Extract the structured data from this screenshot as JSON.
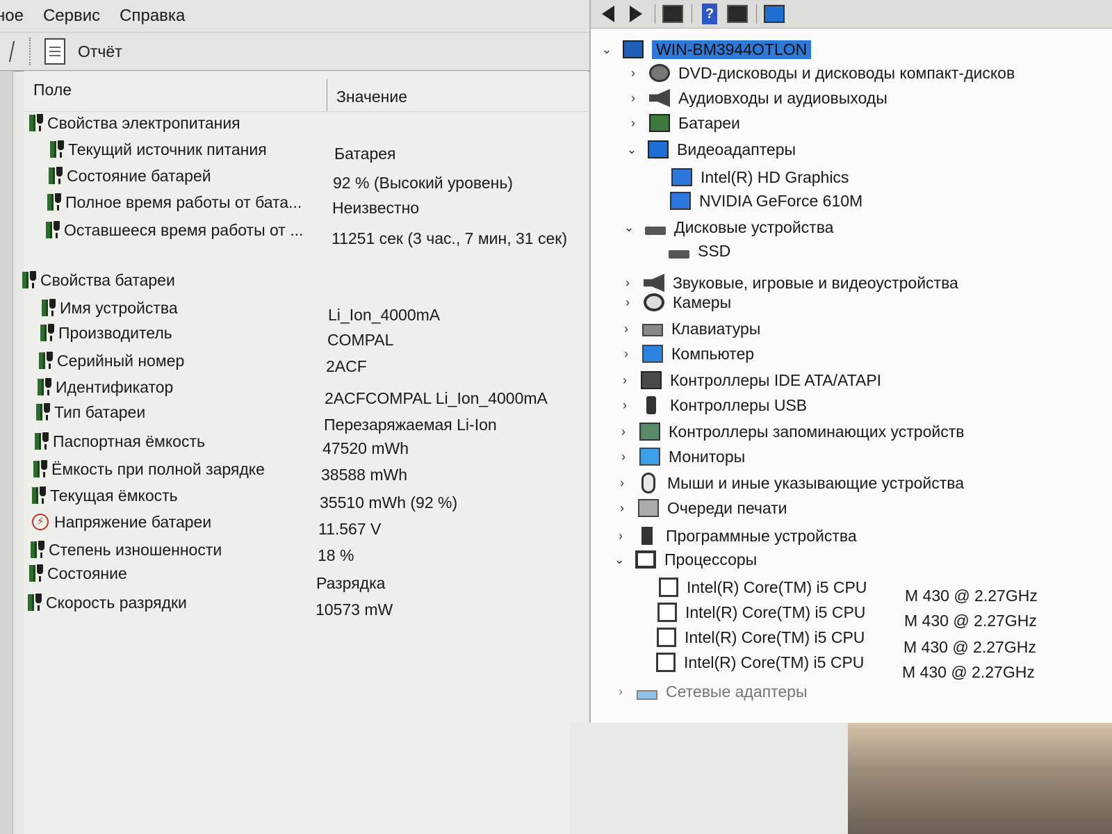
{
  "menu": {
    "items": [
      "ное",
      "Сервис",
      "Справка"
    ]
  },
  "toolbar": {
    "report_label": "Отчёт"
  },
  "report": {
    "header": {
      "field": "Поле",
      "value": "Значение"
    },
    "sections": [
      {
        "title": "Свойства электропитания",
        "rows": [
          {
            "label": "Текущий источник питания",
            "value": "Батарея"
          },
          {
            "label": "Состояние батарей",
            "value": "92 % (Высокий уровень)"
          },
          {
            "label": "Полное время работы от бата...",
            "value": "Неизвестно"
          },
          {
            "label": "Оставшееся время работы от ...",
            "value": "11251 сек (3 час., 7 мин, 31 сек)"
          }
        ]
      },
      {
        "title": "Свойства батареи",
        "rows": [
          {
            "label": "Имя устройства",
            "value": "Li_Ion_4000mA"
          },
          {
            "label": "Производитель",
            "value": "COMPAL"
          },
          {
            "label": "Серийный номер",
            "value": "2ACF"
          },
          {
            "label": "Идентификатор",
            "value": "2ACFCOMPAL Li_Ion_4000mA"
          },
          {
            "label": "Тип батареи",
            "value": "Перезаряжаемая Li-Ion"
          },
          {
            "label": "Паспортная ёмкость",
            "value": "47520 mWh"
          },
          {
            "label": "Ёмкость при полной зарядке",
            "value": "38588 mWh"
          },
          {
            "label": "Текущая ёмкость",
            "value": "35510 mWh  (92 %)"
          },
          {
            "label": "Напряжение батареи",
            "value": "11.567 V",
            "icon": "voltage-icon"
          },
          {
            "label": "Степень изношенности",
            "value": "18 %"
          },
          {
            "label": "Состояние",
            "value": "Разрядка"
          },
          {
            "label": "Скорость разрядки",
            "value": "10573 mW"
          }
        ]
      }
    ]
  },
  "device_manager": {
    "root": "WIN-BM3944OTLON",
    "nodes": [
      {
        "label": "DVD-дисководы и дисководы компакт-дисков",
        "expanded": false,
        "icon": "disc-drive-icon"
      },
      {
        "label": "Аудиовходы и аудиовыходы",
        "expanded": false,
        "icon": "speaker-icon"
      },
      {
        "label": "Батареи",
        "expanded": false,
        "icon": "battery-icon"
      },
      {
        "label": "Видеоадаптеры",
        "expanded": true,
        "icon": "display-adapter-icon",
        "children": [
          "Intel(R) HD Graphics",
          "NVIDIA GeForce 610M"
        ]
      },
      {
        "label": "Дисковые устройства",
        "expanded": true,
        "icon": "disk-drive-icon",
        "children": [
          "SSD"
        ]
      },
      {
        "label": "Звуковые, игровые и видеоустройства",
        "expanded": false,
        "icon": "sound-icon"
      },
      {
        "label": "Камеры",
        "expanded": false,
        "icon": "camera-icon"
      },
      {
        "label": "Клавиатуры",
        "expanded": false,
        "icon": "keyboard-icon"
      },
      {
        "label": "Компьютер",
        "expanded": false,
        "icon": "computer-icon"
      },
      {
        "label": "Контроллеры IDE ATA/ATAPI",
        "expanded": false,
        "icon": "ide-controller-icon"
      },
      {
        "label": "Контроллеры USB",
        "expanded": false,
        "icon": "usb-icon"
      },
      {
        "label": "Контроллеры запоминающих устройств",
        "expanded": false,
        "icon": "storage-controller-icon"
      },
      {
        "label": "Мониторы",
        "expanded": false,
        "icon": "monitor-icon"
      },
      {
        "label": "Мыши и иные указывающие устройства",
        "expanded": false,
        "icon": "mouse-icon"
      },
      {
        "label": "Очереди печати",
        "expanded": false,
        "icon": "printer-icon"
      },
      {
        "label": "Программные устройства",
        "expanded": false,
        "icon": "software-device-icon"
      },
      {
        "label": "Процессоры",
        "expanded": true,
        "icon": "processor-icon",
        "children": [
          {
            "name": "Intel(R) Core(TM) i5 CPU",
            "suffix": "M 430  @ 2.27GHz"
          },
          {
            "name": "Intel(R) Core(TM) i5 CPU",
            "suffix": "M 430  @ 2.27GHz"
          },
          {
            "name": "Intel(R) Core(TM) i5 CPU",
            "suffix": "M 430  @ 2.27GHz"
          },
          {
            "name": "Intel(R) Core(TM) i5 CPU",
            "suffix": "M 430  @ 2.27GHz"
          }
        ]
      },
      {
        "label": "Сетевые адаптеры",
        "expanded": false,
        "icon": "network-adapter-icon"
      }
    ]
  },
  "colors": {
    "root_highlight": "#2e78d8",
    "battery_green": "#2e6b2e",
    "voltage_red": "#c7322a"
  }
}
